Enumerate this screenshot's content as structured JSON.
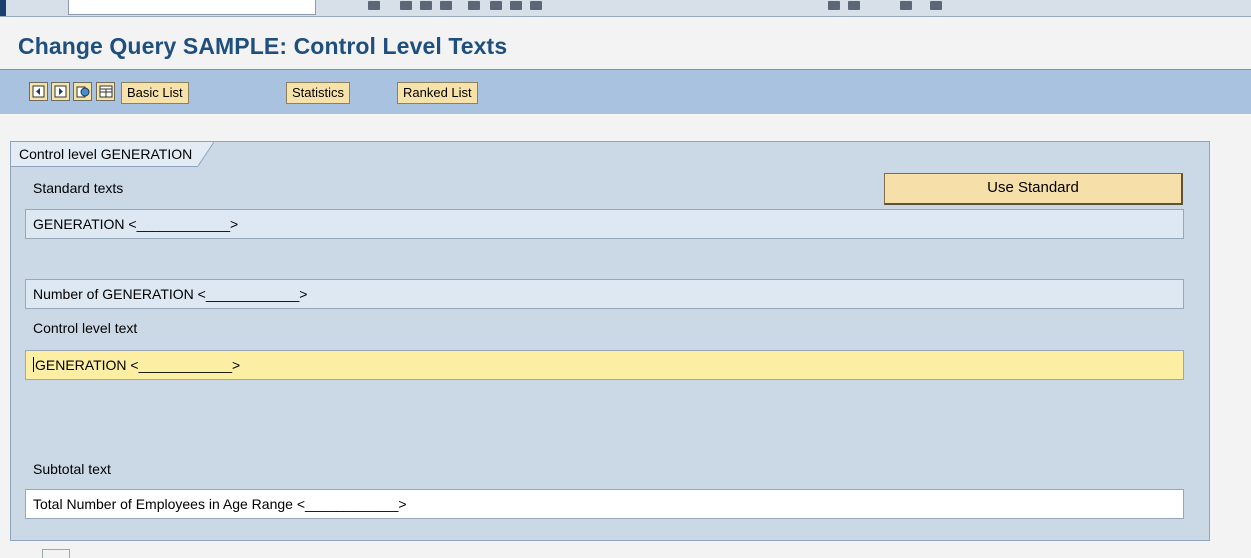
{
  "window": {
    "title": "Change Query SAMPLE: Control Level Texts"
  },
  "toolbar": {
    "icons": [
      "previous-page-icon",
      "next-page-icon",
      "globe-icon",
      "layout-icon"
    ],
    "buttons": {
      "basic_list": "Basic List",
      "statistics": "Statistics",
      "ranked_list": "Ranked List"
    }
  },
  "group": {
    "title": "Control level GENERATION",
    "standard_texts_label": "Standard texts",
    "use_standard_label": "Use Standard",
    "standard_text_1": "GENERATION <____________>",
    "standard_text_2": "Number of GENERATION <____________>",
    "control_level_text_label": "Control level text",
    "control_level_text_value": "GENERATION <____________>",
    "subtotal_text_label": "Subtotal text",
    "subtotal_text_value": "Total Number of Employees in Age Range <____________>"
  },
  "colors": {
    "title": "#1f4f7f",
    "toolbar_bg": "#a8c2df",
    "group_bg": "#cbd9e7",
    "button_bg": "#f7e3aa",
    "active_field": "#fcefa3"
  }
}
